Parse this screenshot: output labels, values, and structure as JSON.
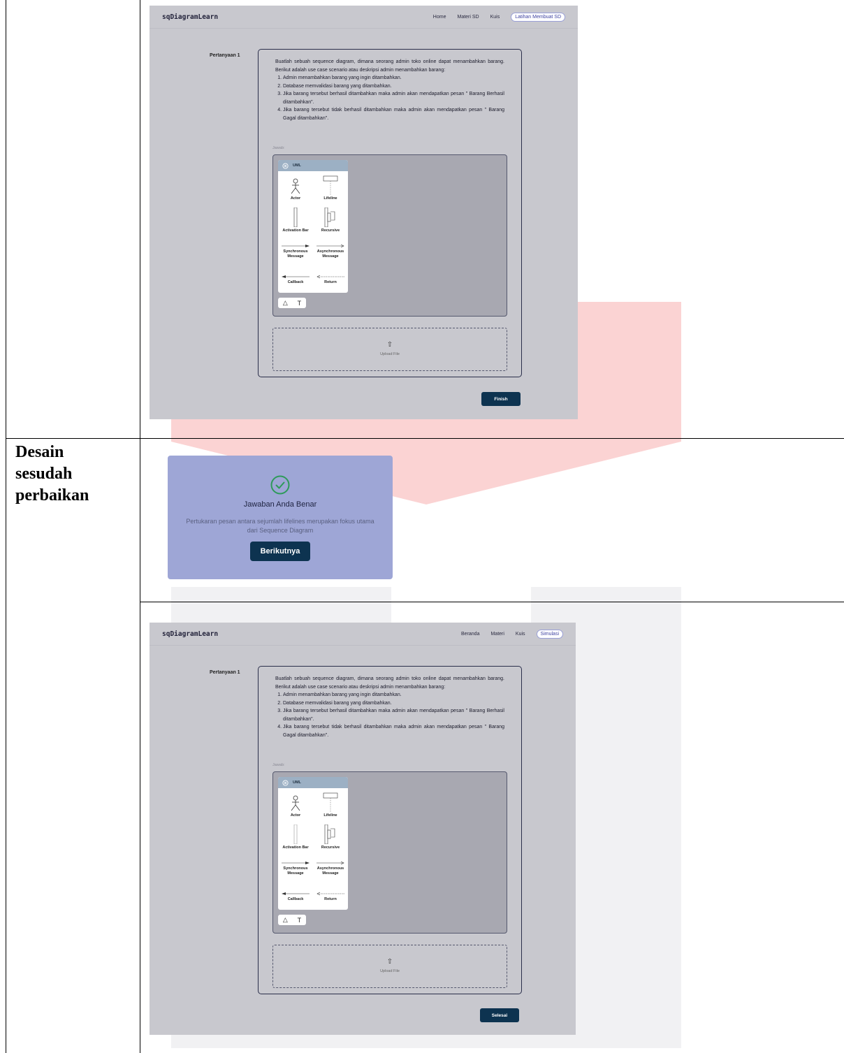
{
  "table": {
    "row_label_lines": [
      "Desain",
      "sesudah",
      "perbaikan"
    ]
  },
  "before": {
    "brand": "sqDiagramLearn",
    "nav": [
      "Home",
      "Materi SD",
      "Kuis",
      "Latihan Membuat SD"
    ],
    "active_nav": "Latihan Membuat SD",
    "question_label": "Pertanyaan 1",
    "question_intro": "Buatlah sebuah sequence diagram, dimana seorang admin toko online dapat menambahkan barang. Berikut adalah use case scenario atau deskripsi admin menambahkan barang:",
    "steps": [
      "Admin menambahkan barang yang ingin ditambahkan.",
      "Database memvalidasi barang yang ditambahkan.",
      "Jika barang tersebut berhasil ditambahkan maka admin akan mendapatkan pesan \" Barang Berhasil ditambahkan\".",
      "Jika barang tersebut tidak berhasil ditambahkan maka admin akan mendapatkan pesan \" Barang Gagal ditambahkan\"."
    ],
    "answer_label": "Jawab:",
    "palette_title": "UML",
    "palette_items": [
      "Actor",
      "Lifeline",
      "Activation Bar",
      "Recursive",
      "Synchronous Message",
      "Asynchronous Message",
      "Callback",
      "Return"
    ],
    "object_label": "Object",
    "upload_label": "Upload File",
    "submit_label": "Finish"
  },
  "modal": {
    "title": "Jawaban Anda Benar",
    "description": "Pertukaran pesan antara sejumlah lifelines merupakan fokus utama dari Sequence Diagram",
    "button": "Berikutnya",
    "success_color": "#2e9a5a"
  },
  "after": {
    "brand": "sqDiagramLearn",
    "nav": [
      "Beranda",
      "Materi",
      "Kuis",
      "Simulasi"
    ],
    "active_nav": "Simulasi",
    "question_label": "Pertanyaan 1",
    "question_intro": "Buatlah sebuah sequence diagram, dimana seorang admin toko online dapat menambahkan barang. Berikut adalah use case scenario atau deskripsi admin menambahkan barang:",
    "steps": [
      "Admin menambahkan barang yang ingin ditambahkan.",
      "Database memvalidasi barang yang ditambahkan.",
      "Jika barang tersebut berhasil ditambahkan maka admin akan mendapatkan pesan \" Barang Berhasil ditambahkan\".",
      "Jika barang tersebut tidak berhasil ditambahkan maka admin akan mendapatkan pesan \" Barang Gagal ditambahkan\"."
    ],
    "answer_label": "Jawab:",
    "palette_title": "UML",
    "palette_items": [
      "Actor",
      "Lifeline",
      "Activation Bar",
      "Recursive",
      "Synchronous Message",
      "Asynchronous Message",
      "Callback",
      "Return"
    ],
    "object_label": "Object",
    "upload_label": "Upload File",
    "submit_label": "Selesai"
  },
  "colors": {
    "primary_button": "#0d3350",
    "screen_bg": "#c8c8ce",
    "modal_bg": "#9ea6d6",
    "watermark_red": "#fbd3d3"
  }
}
